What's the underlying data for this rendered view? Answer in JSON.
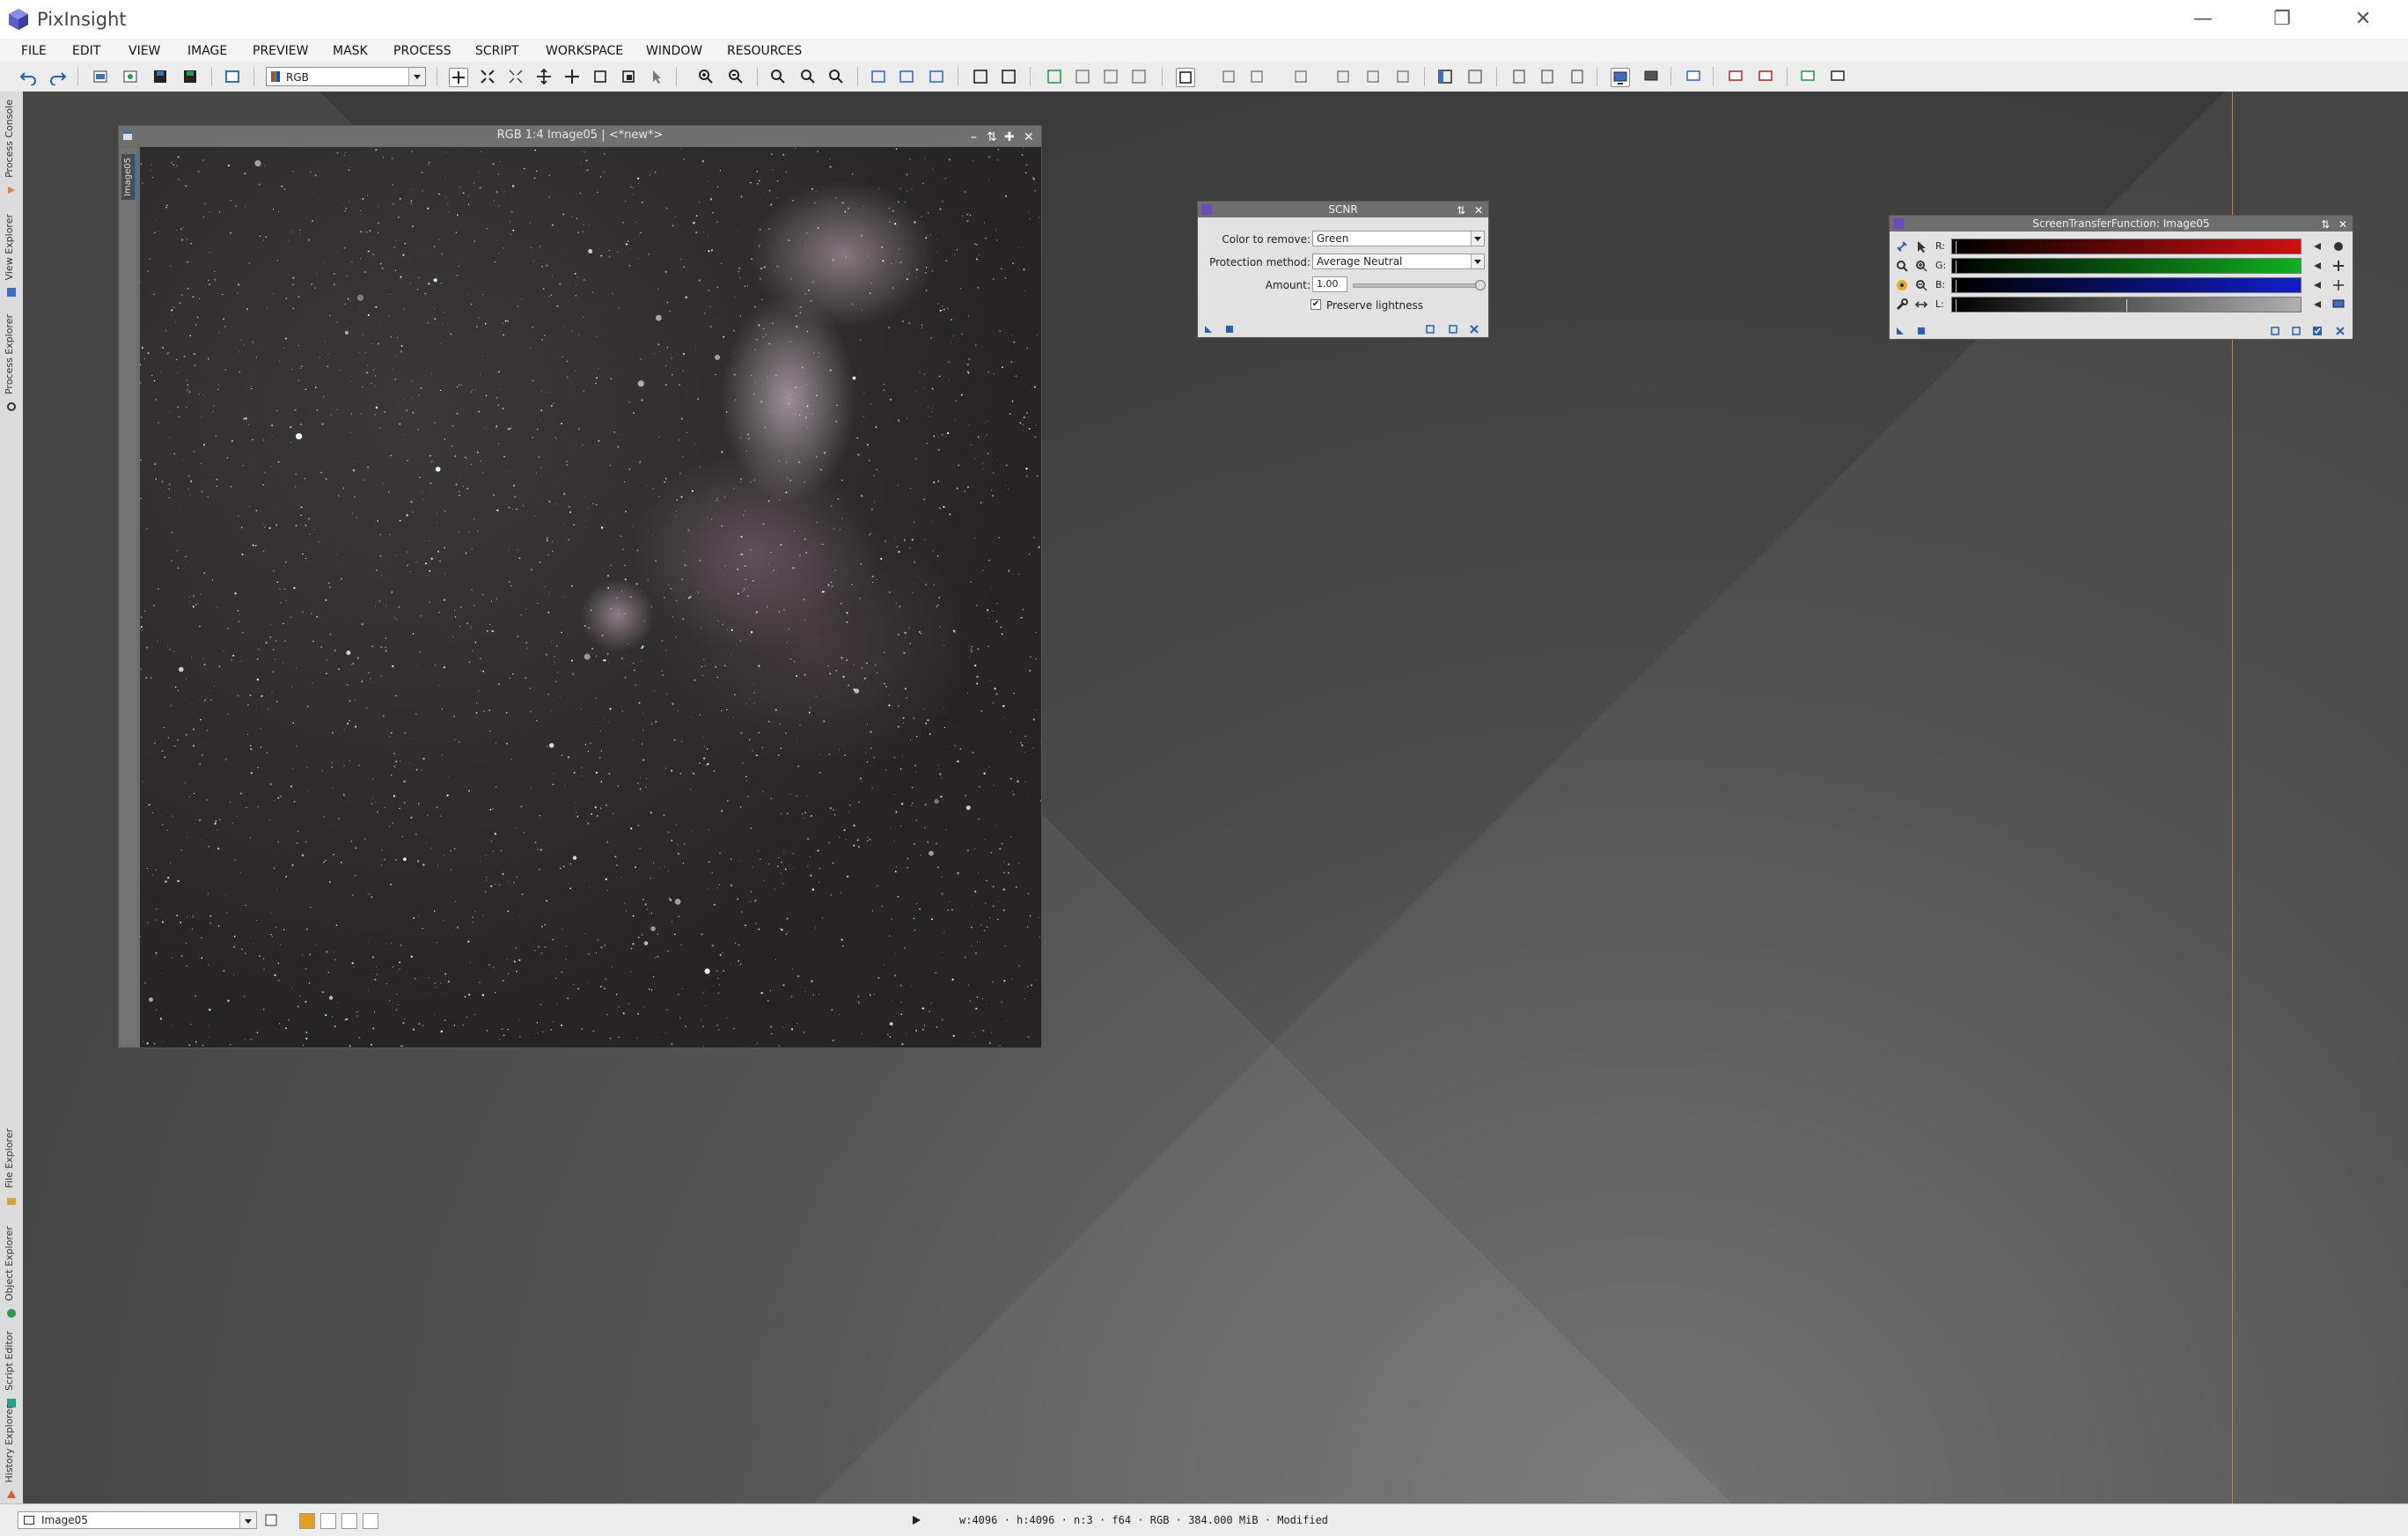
{
  "app": {
    "title": "PixInsight",
    "logo_icon": "pixinsight-cube-icon"
  },
  "window_controls": [
    "minimize-icon",
    "restore-icon",
    "close-icon"
  ],
  "menu": [
    "FILE",
    "EDIT",
    "VIEW",
    "IMAGE",
    "PREVIEW",
    "MASK",
    "PROCESS",
    "SCRIPT",
    "WORKSPACE",
    "WINDOW",
    "RESOURCES"
  ],
  "toolbar": {
    "channel_selector": "RGB"
  },
  "left_dock": {
    "top_tabs": [
      "Process Console",
      "View Explorer",
      "Process Explorer"
    ],
    "bottom_tabs": [
      "File Explorer",
      "Object Explorer",
      "Script Editor",
      "History Explorer"
    ]
  },
  "image_window": {
    "title": "RGB 1:4 Image05 | <*new*>",
    "side_tab": "Image05"
  },
  "scnr": {
    "title": "SCNR",
    "color_to_remove_label": "Color to remove:",
    "color_to_remove_value": "Green",
    "protection_method_label": "Protection method:",
    "protection_method_value": "Average Neutral",
    "amount_label": "Amount:",
    "amount_value": "1.00",
    "amount_fraction": 1.0,
    "preserve_lightness_label": "Preserve lightness",
    "preserve_lightness_checked": true
  },
  "stf": {
    "title": "ScreenTransferFunction: Image05",
    "channels": [
      {
        "label": "R:",
        "color": "#d01010"
      },
      {
        "label": "G:",
        "color": "#10b020"
      },
      {
        "label": "B:",
        "color": "#1020c8"
      },
      {
        "label": "L:",
        "color": "#b0b0b0"
      }
    ],
    "l_midtone_fraction": 0.5
  },
  "status": {
    "view": "Image05",
    "info": "w:4096 · h:4096 · n:3 · f64 · RGB · 384.000 MiB · Modified"
  }
}
